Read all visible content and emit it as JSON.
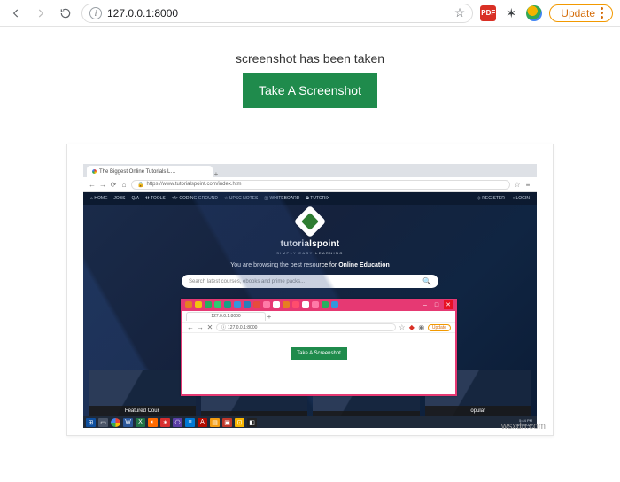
{
  "browser": {
    "url": "127.0.0.1:8000",
    "update_label": "Update",
    "pdf_icon_label": "PDF"
  },
  "page": {
    "status": "screenshot has been taken",
    "button_label": "Take A Screenshot"
  },
  "footer_credit": "wsxdn.com",
  "inner": {
    "tab_title": "The Biggest Online Tutorials L…",
    "url": "https://www.tutorialspoint.com/index.htm",
    "nav": [
      "⌂ HOME",
      "JOBS",
      "Q/A",
      "⚒ TOOLS",
      "</> CODING GROUND",
      "☆ UPSC NOTES",
      "◫ WHITEBOARD",
      "⧉ TUTORIX"
    ],
    "nav_right": [
      "⎆ REGISTER",
      "⇥ LOGIN"
    ],
    "brand": "tutorialspoint",
    "brand_sub": "SIMPLY EASY LEARNING",
    "tagline_a": "You are browsing the best resource for ",
    "tagline_b": "Online Education",
    "search_placeholder": "Search latest courses, ebooks and prime packs...",
    "cards": [
      "Featured Cour",
      "",
      "",
      "opular"
    ]
  },
  "nested": {
    "tab_title": "127.0.0.1:8000",
    "url": "127.0.0.1:8000",
    "update_label": "Update",
    "button_label": "Take A Screenshot",
    "titlebar_icons": [
      "#e67e22",
      "#f1c40f",
      "#27ae60",
      "#2ecc71",
      "#16a085",
      "#3498db",
      "#2980b9",
      "#e74c3c",
      "#ff7aa8",
      "#ffffff",
      "#e67e22",
      "#ff4d6d",
      "#ffffff",
      "#ff7aa8",
      "#27ae60",
      "#3498db"
    ]
  },
  "taskbar": {
    "icons": [
      {
        "bg": "#0e4f9e",
        "txt": "⊞"
      },
      {
        "bg": "#4a5568",
        "txt": "▭"
      },
      {
        "bg": "#fff",
        "txt": "",
        "ring": true
      },
      {
        "bg": "#2b579a",
        "txt": "W"
      },
      {
        "bg": "#217346",
        "txt": "X"
      },
      {
        "bg": "#ff6a00",
        "txt": "◐"
      },
      {
        "bg": "#d72f2f",
        "txt": "✶"
      },
      {
        "bg": "#5a3ea5",
        "txt": "⎔"
      },
      {
        "bg": "#0078d4",
        "txt": "≡"
      },
      {
        "bg": "#b30b00",
        "txt": "A"
      },
      {
        "bg": "#f39c12",
        "txt": "▤"
      },
      {
        "bg": "#c0392b",
        "txt": "▣"
      },
      {
        "bg": "#f8b500",
        "txt": "⊡"
      },
      {
        "bg": "#222",
        "txt": "◧"
      }
    ],
    "time": "5:44 PM",
    "date": "8/21/2021"
  }
}
